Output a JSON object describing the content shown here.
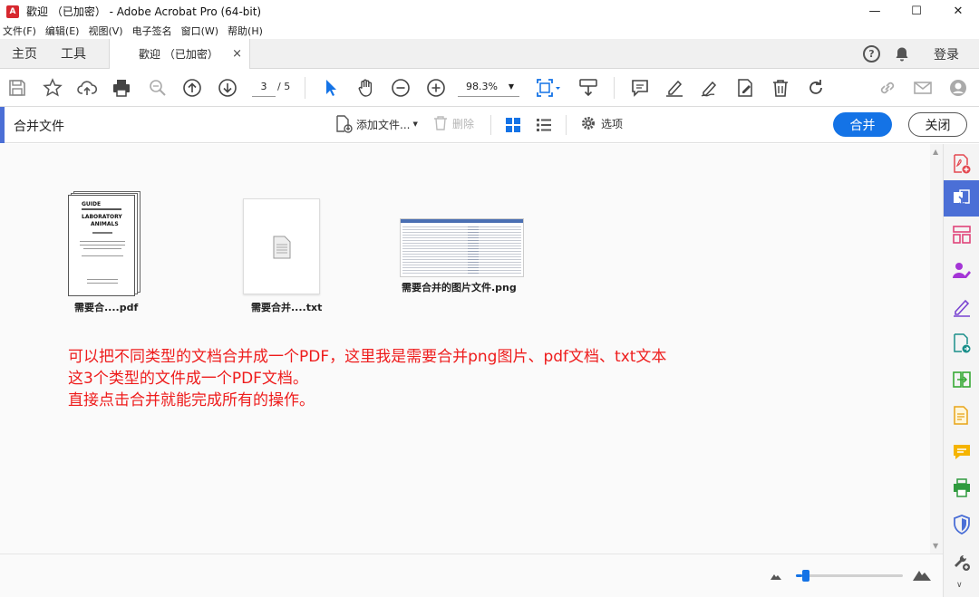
{
  "window": {
    "title": "歡迎 （已加密） - Adobe Acrobat Pro (64-bit)",
    "minimize": "—",
    "maximize": "☐",
    "close": "✕"
  },
  "menubar": {
    "items": [
      "文件(F)",
      "编辑(E)",
      "视图(V)",
      "电子签名",
      "窗口(W)",
      "帮助(H)"
    ]
  },
  "tabs": {
    "home": "主页",
    "tools": "工具",
    "document": "歡迎 （已加密）",
    "document_close": "×",
    "help": "?",
    "login": "登录"
  },
  "toolbar": {
    "page_current": "3",
    "page_total": "/ 5",
    "zoom": "98.3%"
  },
  "merge": {
    "title": "合并文件",
    "add_files": "添加文件...",
    "delete": "删除",
    "options": "选项",
    "merge_button": "合并",
    "close_button": "关闭"
  },
  "files": [
    {
      "name": "需要合....pdf",
      "type": "pdf"
    },
    {
      "name": "需要合并....txt",
      "type": "txt"
    },
    {
      "name": "需要合并的图片文件.png",
      "type": "png"
    }
  ],
  "pdf_cover": {
    "title_line1": "GUIDE",
    "title_line2": "LABORATORY",
    "title_line3": "ANIMALS"
  },
  "note": {
    "line1": "可以把不同类型的文档合并成一个PDF，这里我是需要合并png图片、pdf文档、txt文本",
    "line2": "这3个类型的文件成一个PDF文档。",
    "line3": "直接点击合并就能完成所有的操作。"
  },
  "thumbnail_zoom_fraction": 0.06,
  "colors": {
    "accent": "#1473e6",
    "side_accent": "#4b6fd6",
    "note_red": "#ee1c1c"
  },
  "right_tools": [
    "create-pdf-icon",
    "combine-files-icon",
    "organize-pages-icon",
    "request-signature-icon",
    "fill-sign-icon",
    "export-pdf-icon",
    "compress-icon",
    "edit-pdf-icon",
    "comment-icon",
    "print-production-icon",
    "protect-icon",
    "more-tools-icon"
  ]
}
